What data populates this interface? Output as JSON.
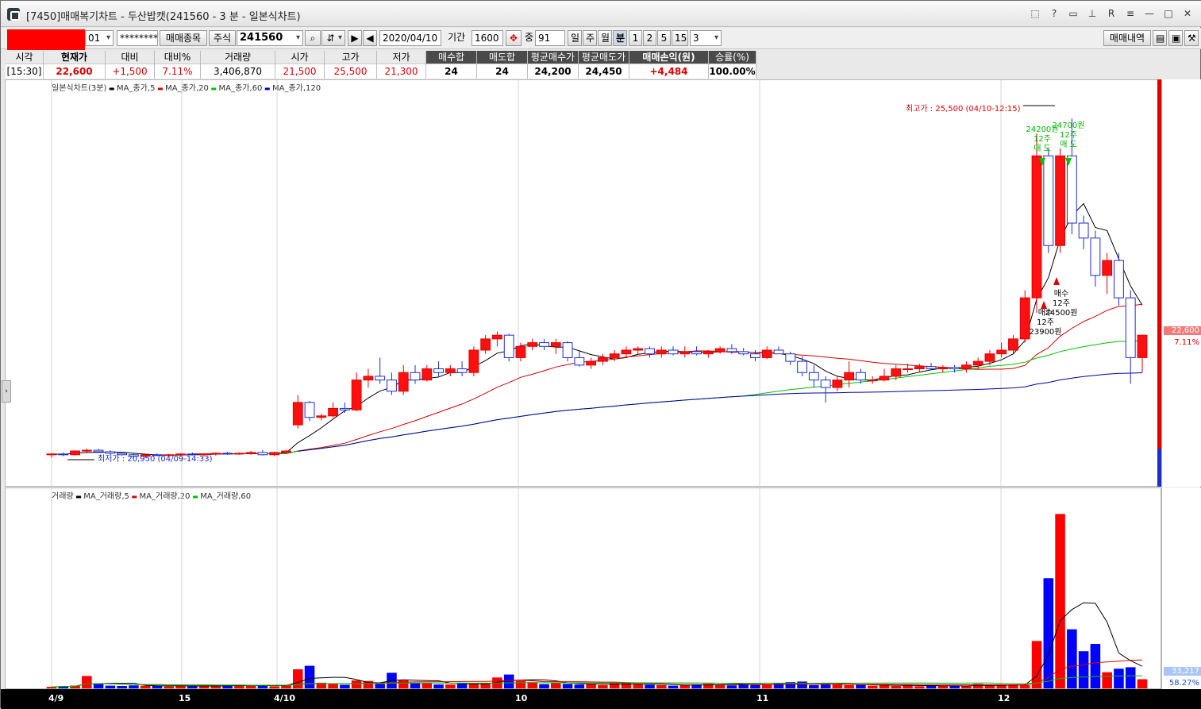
{
  "window": {
    "title": "[7450]매매복기차트 - 두산밥캣(241560 - 3 분 - 일본식차트)",
    "controls": [
      "restore-icon",
      "help-icon",
      "window-icon",
      "pin-icon",
      "r-icon",
      "menu-icon",
      "minimize-icon",
      "maximize-icon",
      "close-icon"
    ]
  },
  "toolbar": {
    "account_suffix": "01",
    "password": "********",
    "trade_items_label": "매매종목",
    "market_label": "주식",
    "code": "241560",
    "date": "2020/04/10",
    "period_label": "기간",
    "period_value": "1600",
    "count_label": "중",
    "count_value": "91",
    "timeframes": [
      "일",
      "주",
      "월",
      "분"
    ],
    "active_timeframe": "분",
    "minute_options": [
      "1",
      "2",
      "5",
      "15"
    ],
    "minute_value": "3",
    "trade_history_label": "매매내역"
  },
  "info": {
    "headers": [
      "시각",
      "현재가",
      "대비",
      "대비%",
      "거래량",
      "시가",
      "고가",
      "저가",
      "매수합",
      "매도합",
      "평균매수가",
      "평균매도가",
      "매매손익(원)",
      "승률(%)"
    ],
    "values": [
      "[15:30]",
      "22,600",
      "+1,500",
      "7.11%",
      "3,406,870",
      "21,500",
      "25,500",
      "21,300",
      "24",
      "24",
      "24,200",
      "24,450",
      "+4,484",
      "100.00%"
    ]
  },
  "price_legend": {
    "name": "일본식차트(3분)",
    "ma": [
      {
        "label": "MA_종가,5",
        "color": "#000000"
      },
      {
        "label": "MA_종가,20",
        "color": "#e00000"
      },
      {
        "label": "MA_종가,60",
        "color": "#00c000"
      },
      {
        "label": "MA_종가,120",
        "color": "#0000c0"
      }
    ]
  },
  "volume_legend": {
    "name": "거래량",
    "ma": [
      {
        "label": "MA_거래량,5",
        "color": "#000000"
      },
      {
        "label": "MA_거래량,20",
        "color": "#e00000"
      },
      {
        "label": "MA_거래량,60",
        "color": "#00c000"
      }
    ]
  },
  "annotations": {
    "high": "최고가 : 25,500 (04/10-12:15)",
    "low": "최저가 : 20,950 (04/09-14:33)",
    "sell1": [
      "24200원",
      "12주",
      "매 도"
    ],
    "sell2": [
      "24700원",
      "12주",
      "매 도"
    ],
    "buy1": [
      "매수",
      "12주",
      "23900원"
    ],
    "buy2": [
      "매수",
      "12주",
      "24500원"
    ]
  },
  "right_axis": {
    "price_tag": "22,600",
    "price_pct": "7.11%",
    "volume_tag": "33,217",
    "volume_pct": "58.27%"
  },
  "x_labels": [
    "4/9",
    "15",
    "4/10",
    "10",
    "11",
    "12"
  ],
  "chart_data": {
    "type": "candlestick",
    "candles": [
      [
        21000,
        21020,
        20960,
        21010
      ],
      [
        21010,
        21030,
        20980,
        21000
      ],
      [
        21000,
        21060,
        20990,
        21050
      ],
      [
        21050,
        21080,
        21020,
        21060
      ],
      [
        21060,
        21080,
        21030,
        21040
      ],
      [
        21040,
        21060,
        21000,
        21020
      ],
      [
        21020,
        21040,
        20990,
        21000
      ],
      [
        21000,
        21020,
        20950,
        20980
      ],
      [
        20980,
        21010,
        20960,
        21000
      ],
      [
        21000,
        21020,
        20980,
        20990
      ],
      [
        20990,
        21010,
        20970,
        21000
      ],
      [
        21000,
        21020,
        20980,
        21010
      ],
      [
        21010,
        21030,
        20990,
        21000
      ],
      [
        21000,
        21020,
        20980,
        21010
      ],
      [
        21010,
        21030,
        20990,
        21020
      ],
      [
        21020,
        21040,
        21000,
        21010
      ],
      [
        21010,
        21030,
        21000,
        21020
      ],
      [
        21020,
        21050,
        21000,
        21030
      ],
      [
        21030,
        21060,
        20990,
        21000
      ],
      [
        21000,
        21040,
        20980,
        21030
      ],
      [
        21030,
        21060,
        21010,
        21050
      ],
      [
        21400,
        21800,
        21350,
        21700
      ],
      [
        21700,
        21720,
        21450,
        21500
      ],
      [
        21500,
        21550,
        21460,
        21520
      ],
      [
        21520,
        21700,
        21500,
        21620
      ],
      [
        21620,
        21700,
        21560,
        21600
      ],
      [
        21600,
        22100,
        21580,
        22000
      ],
      [
        22000,
        22150,
        21900,
        22050
      ],
      [
        22050,
        22300,
        21950,
        22000
      ],
      [
        22000,
        22100,
        21800,
        21850
      ],
      [
        21850,
        22200,
        21800,
        22100
      ],
      [
        22100,
        22200,
        21950,
        22000
      ],
      [
        22000,
        22200,
        21980,
        22150
      ],
      [
        22150,
        22250,
        22050,
        22100
      ],
      [
        22100,
        22200,
        22050,
        22150
      ],
      [
        22150,
        22250,
        22050,
        22100
      ],
      [
        22100,
        22450,
        22050,
        22400
      ],
      [
        22400,
        22600,
        22350,
        22550
      ],
      [
        22550,
        22650,
        22450,
        22600
      ],
      [
        22600,
        22620,
        22250,
        22300
      ],
      [
        22300,
        22500,
        22250,
        22450
      ],
      [
        22450,
        22550,
        22400,
        22500
      ],
      [
        22500,
        22550,
        22400,
        22450
      ],
      [
        22450,
        22550,
        22350,
        22500
      ],
      [
        22500,
        22520,
        22250,
        22300
      ],
      [
        22300,
        22400,
        22180,
        22200
      ],
      [
        22200,
        22300,
        22150,
        22250
      ],
      [
        22250,
        22350,
        22200,
        22300
      ],
      [
        22300,
        22400,
        22250,
        22350
      ],
      [
        22350,
        22450,
        22300,
        22400
      ],
      [
        22400,
        22450,
        22350,
        22420
      ],
      [
        22420,
        22450,
        22300,
        22350
      ],
      [
        22350,
        22450,
        22300,
        22400
      ],
      [
        22400,
        22450,
        22330,
        22350
      ],
      [
        22350,
        22450,
        22300,
        22380
      ],
      [
        22380,
        22450,
        22330,
        22350
      ],
      [
        22350,
        22400,
        22300,
        22380
      ],
      [
        22380,
        22450,
        22350,
        22420
      ],
      [
        22420,
        22480,
        22350,
        22380
      ],
      [
        22380,
        22430,
        22330,
        22350
      ],
      [
        22350,
        22400,
        22250,
        22300
      ],
      [
        22300,
        22450,
        22280,
        22400
      ],
      [
        22400,
        22450,
        22350,
        22350
      ],
      [
        22350,
        22380,
        22200,
        22250
      ],
      [
        22250,
        22320,
        22050,
        22100
      ],
      [
        22100,
        22200,
        21900,
        22000
      ],
      [
        22000,
        22050,
        21700,
        21900
      ],
      [
        21900,
        22050,
        21850,
        22000
      ],
      [
        22000,
        22250,
        21900,
        22100
      ],
      [
        22100,
        22150,
        21950,
        22000
      ],
      [
        22000,
        22050,
        21950,
        22000
      ],
      [
        22000,
        22150,
        21980,
        22050
      ],
      [
        22050,
        22200,
        22000,
        22150
      ],
      [
        22150,
        22220,
        22100,
        22150
      ],
      [
        22150,
        22220,
        22100,
        22180
      ],
      [
        22180,
        22230,
        22130,
        22150
      ],
      [
        22150,
        22200,
        22100,
        22170
      ],
      [
        22170,
        22200,
        22100,
        22150
      ],
      [
        22150,
        22250,
        22100,
        22200
      ],
      [
        22200,
        22300,
        22150,
        22250
      ],
      [
        22250,
        22400,
        22200,
        22350
      ],
      [
        22350,
        22500,
        22300,
        22400
      ],
      [
        22400,
        22600,
        22350,
        22550
      ],
      [
        22550,
        23200,
        22500,
        23100
      ],
      [
        23100,
        25300,
        22900,
        25000
      ],
      [
        25000,
        25100,
        23700,
        23800
      ],
      [
        23800,
        25100,
        23700,
        25000
      ],
      [
        25000,
        25500,
        23950,
        24100
      ],
      [
        24100,
        24200,
        23750,
        23900
      ],
      [
        23900,
        24000,
        23250,
        23400
      ],
      [
        23400,
        23700,
        23150,
        23600
      ],
      [
        23600,
        23700,
        23000,
        23100
      ],
      [
        23100,
        23200,
        21950,
        22300
      ],
      [
        22300,
        22550,
        22100,
        22600
      ]
    ],
    "volume": [
      8000,
      10000,
      12000,
      45000,
      20000,
      12000,
      11000,
      13000,
      12000,
      11000,
      10000,
      11000,
      10000,
      12000,
      11000,
      13000,
      15000,
      11000,
      12000,
      10000,
      14000,
      68000,
      80000,
      22000,
      18000,
      15000,
      30000,
      28000,
      18000,
      56000,
      30000,
      20000,
      21000,
      16000,
      16000,
      22000,
      18000,
      20000,
      40000,
      50000,
      28000,
      24000,
      17000,
      22000,
      18000,
      16000,
      17000,
      14000,
      20000,
      22000,
      16000,
      15000,
      14000,
      12000,
      14000,
      16000,
      18000,
      16000,
      13000,
      18000,
      14000,
      16000,
      20000,
      24000,
      26000,
      14000,
      18000,
      16000,
      14000,
      15000,
      12000,
      14000,
      11000,
      14000,
      10000,
      12000,
      11000,
      12000,
      10000,
      18000,
      14000,
      13000,
      16000,
      14000,
      165000,
      380000,
      600000,
      205000,
      130000,
      155000,
      58000,
      70000,
      75000,
      34000
    ],
    "price_ylim": [
      20700,
      25800
    ],
    "volume_ylim": [
      0,
      650000
    ]
  }
}
